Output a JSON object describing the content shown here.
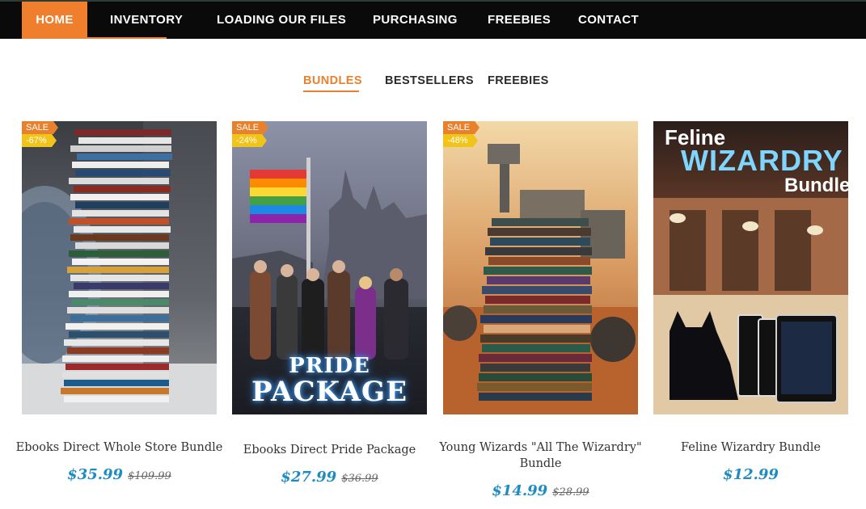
{
  "nav": {
    "home": "HOME",
    "inventory": "INVENTORY",
    "loading": "LOADING OUR FILES",
    "purchasing": "PURCHASING",
    "freebies": "FREEBIES",
    "contact": "CONTACT"
  },
  "tabs": {
    "bundles": "BUNDLES",
    "bestsellers": "BESTSELLERS",
    "freebies": "FREEBIES"
  },
  "products": [
    {
      "title": "Ebooks Direct Whole Store Bundle",
      "price": "$35.99",
      "old_price": "$109.99",
      "sale": "SALE",
      "discount": "-67%"
    },
    {
      "title": "Ebooks Direct Pride Package",
      "price": "$27.99",
      "old_price": "$36.99",
      "sale": "SALE",
      "discount": "-24%",
      "cover_line1": "PRIDE",
      "cover_line2": "PACKAGE"
    },
    {
      "title": "Young Wizards \"All The Wizardry\" Bundle",
      "price": "$14.99",
      "old_price": "$28.99",
      "sale": "SALE",
      "discount": "-48%"
    },
    {
      "title": "Feline Wizardry Bundle",
      "price": "$12.99",
      "cover_line1": "Feline",
      "cover_line2": "WIZARDRY",
      "cover_line3": "Bundle"
    }
  ],
  "colors": {
    "accent": "#e8812d",
    "price": "#1e8bc3",
    "discount_badge": "#f0c419",
    "nav_bg": "#0a0a0a"
  }
}
